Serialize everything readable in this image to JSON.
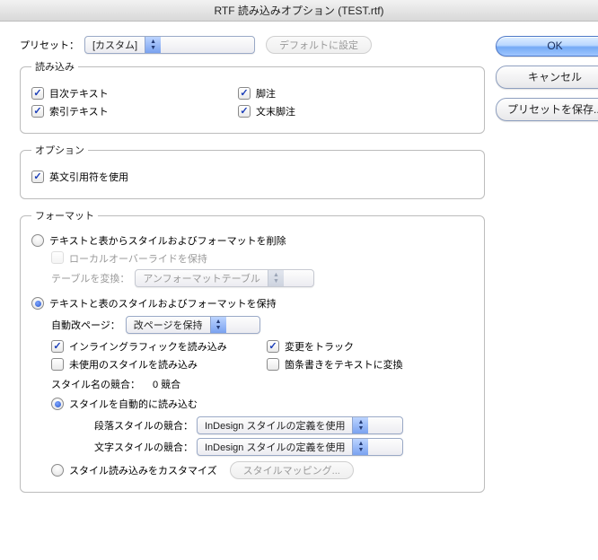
{
  "titlebar": "RTF 読み込みオプション (TEST.rtf)",
  "preset": {
    "label": "プリセット：",
    "value": "[カスタム]",
    "set_default_label": "デフォルトに設定"
  },
  "buttons": {
    "ok": "OK",
    "cancel": "キャンセル",
    "save_preset": "プリセットを保存..."
  },
  "groups": {
    "import": {
      "legend": "読み込み",
      "toc_text": "目次テキスト",
      "footnotes": "脚注",
      "index_text": "索引テキスト",
      "endnotes": "文末脚注"
    },
    "options": {
      "legend": "オプション",
      "typographers_quotes": "英文引用符を使用"
    },
    "format": {
      "legend": "フォーマット",
      "remove_styles": "テキストと表からスタイルおよびフォーマットを削除",
      "preserve_local": "ローカルオーバーライドを保持",
      "convert_tables_label": "テーブルを変換：",
      "convert_tables_value": "アンフォーマットテーブル",
      "preserve_styles": "テキストと表のスタイルおよびフォーマットを保持",
      "manual_pagebreaks_label": "自動改ページ：",
      "manual_pagebreaks_value": "改ページを保持",
      "inline_graphics": "インライングラフィックを読み込み",
      "track_changes": "変更をトラック",
      "unused_styles": "未使用のスタイルを読み込み",
      "bullets_to_text": "箇条書きをテキストに変換",
      "style_conflicts_label": "スタイル名の競合：",
      "style_conflicts_value": "0 競合",
      "auto_import_styles": "スタイルを自動的に読み込む",
      "para_conflict_label": "段落スタイルの競合：",
      "para_conflict_value": "InDesign スタイルの定義を使用",
      "char_conflict_label": "文字スタイルの競合：",
      "char_conflict_value": "InDesign スタイルの定義を使用",
      "customize_import": "スタイル読み込みをカスタマイズ",
      "style_mapping_btn": "スタイルマッピング..."
    }
  }
}
